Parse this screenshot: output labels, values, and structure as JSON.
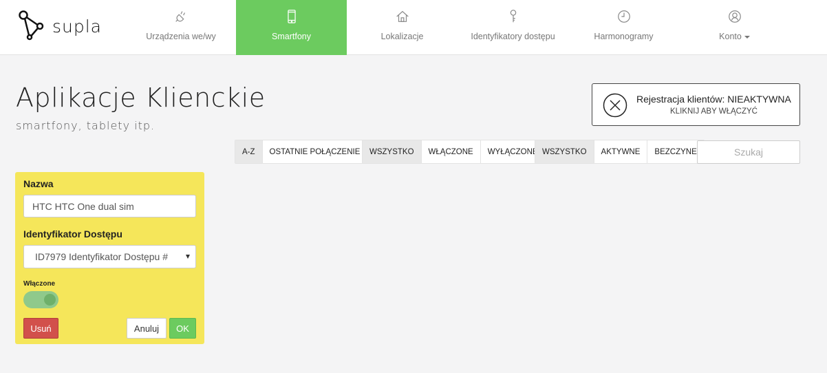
{
  "app": {
    "logo_text": "supla"
  },
  "nav": [
    {
      "label": "Urządzenia we/wy",
      "icon": "plug-icon"
    },
    {
      "label": "Smartfony",
      "icon": "smartphone-icon",
      "active": true
    },
    {
      "label": "Lokalizacje",
      "icon": "home-icon"
    },
    {
      "label": "Identyfikatory dostępu",
      "icon": "key-icon"
    },
    {
      "label": "Harmonogramy",
      "icon": "clock-icon"
    },
    {
      "label": "Konto",
      "icon": "user-icon"
    }
  ],
  "page": {
    "title": "Aplikacje Klienckie",
    "subtitle": "smartfony, tablety itp."
  },
  "registration": {
    "title": "Rejestracja klientów: NIEAKTYWNA",
    "action": "KLIKNIJ ABY WŁĄCZYĆ"
  },
  "filters": {
    "sort": [
      "A-Z",
      "OSTATNIE POŁĄCZENIE"
    ],
    "enabled": [
      "WSZYSTKO",
      "WŁĄCZONE",
      "WYŁĄCZONE"
    ],
    "connection": [
      "WSZYSTKO",
      "AKTYWNE",
      "BEZCZYNE"
    ],
    "search_placeholder": "Szukaj"
  },
  "card": {
    "name_label": "Nazwa",
    "name_value": "HTC HTC One dual sim",
    "access_label": "Identyfikator Dostępu",
    "access_value": "ID7979 Identyfikator Dostępu #",
    "enabled_label": "Włączone",
    "enabled": true,
    "delete_label": "Usuń",
    "cancel_label": "Anuluj",
    "ok_label": "OK"
  },
  "colors": {
    "accent": "#6ccb5f",
    "card_bg": "#f5e65a",
    "danger": "#d2504b"
  }
}
